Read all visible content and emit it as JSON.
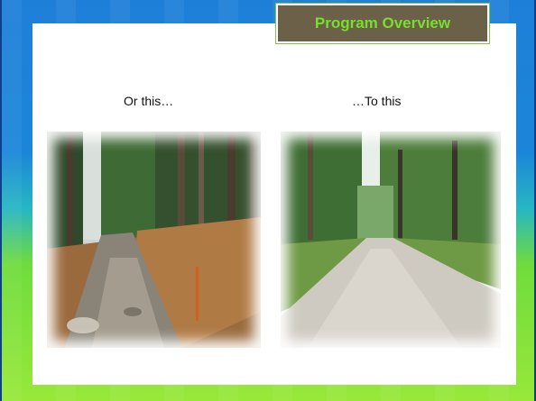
{
  "slide": {
    "title": "Program Overview",
    "left_caption": "Or this…",
    "right_caption": "…To this"
  },
  "images": {
    "left_photo": "eroded-dirt-forest-road",
    "right_photo": "improved-gravel-forest-road"
  },
  "colors": {
    "title_bg": "#6b6048",
    "title_text": "#76e02a",
    "bg_top": "#1e7fd8",
    "bg_bottom": "#98e83a"
  }
}
